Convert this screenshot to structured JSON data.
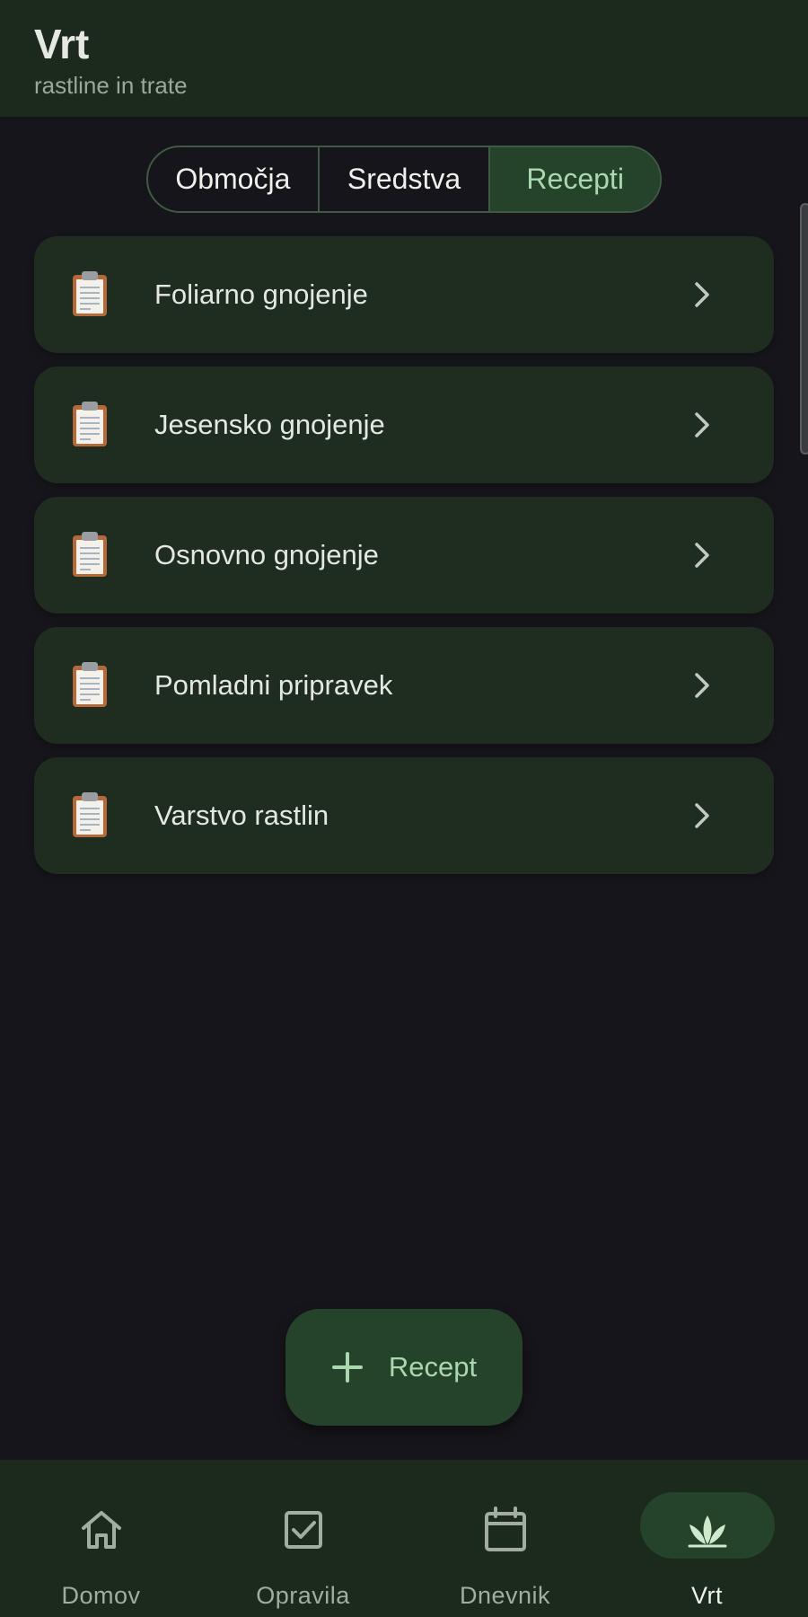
{
  "header": {
    "title": "Vrt",
    "subtitle": "rastline in trate"
  },
  "tabs": [
    {
      "label": "Območja",
      "active": false
    },
    {
      "label": "Sredstva",
      "active": false
    },
    {
      "label": "Recepti",
      "active": true
    }
  ],
  "recipes": [
    {
      "label": "Foliarno gnojenje",
      "icon": "clipboard-icon"
    },
    {
      "label": "Jesensko gnojenje",
      "icon": "clipboard-icon"
    },
    {
      "label": "Osnovno gnojenje",
      "icon": "clipboard-icon"
    },
    {
      "label": "Pomladni pripravek",
      "icon": "clipboard-icon"
    },
    {
      "label": "Varstvo rastlin",
      "icon": "clipboard-icon"
    }
  ],
  "fab": {
    "label": "Recept",
    "icon": "plus-icon"
  },
  "bottom_nav": [
    {
      "label": "Domov",
      "icon": "home-icon",
      "active": false
    },
    {
      "label": "Opravila",
      "icon": "checkbox-icon",
      "active": false
    },
    {
      "label": "Dnevnik",
      "icon": "calendar-icon",
      "active": false
    },
    {
      "label": "Vrt",
      "icon": "plant-icon",
      "active": true
    }
  ],
  "colors": {
    "background": "#16151b",
    "surface": "#1f2d21",
    "header": "#1c2a1d",
    "accent_container": "#25432b",
    "accent_text": "#a9d7ae"
  }
}
